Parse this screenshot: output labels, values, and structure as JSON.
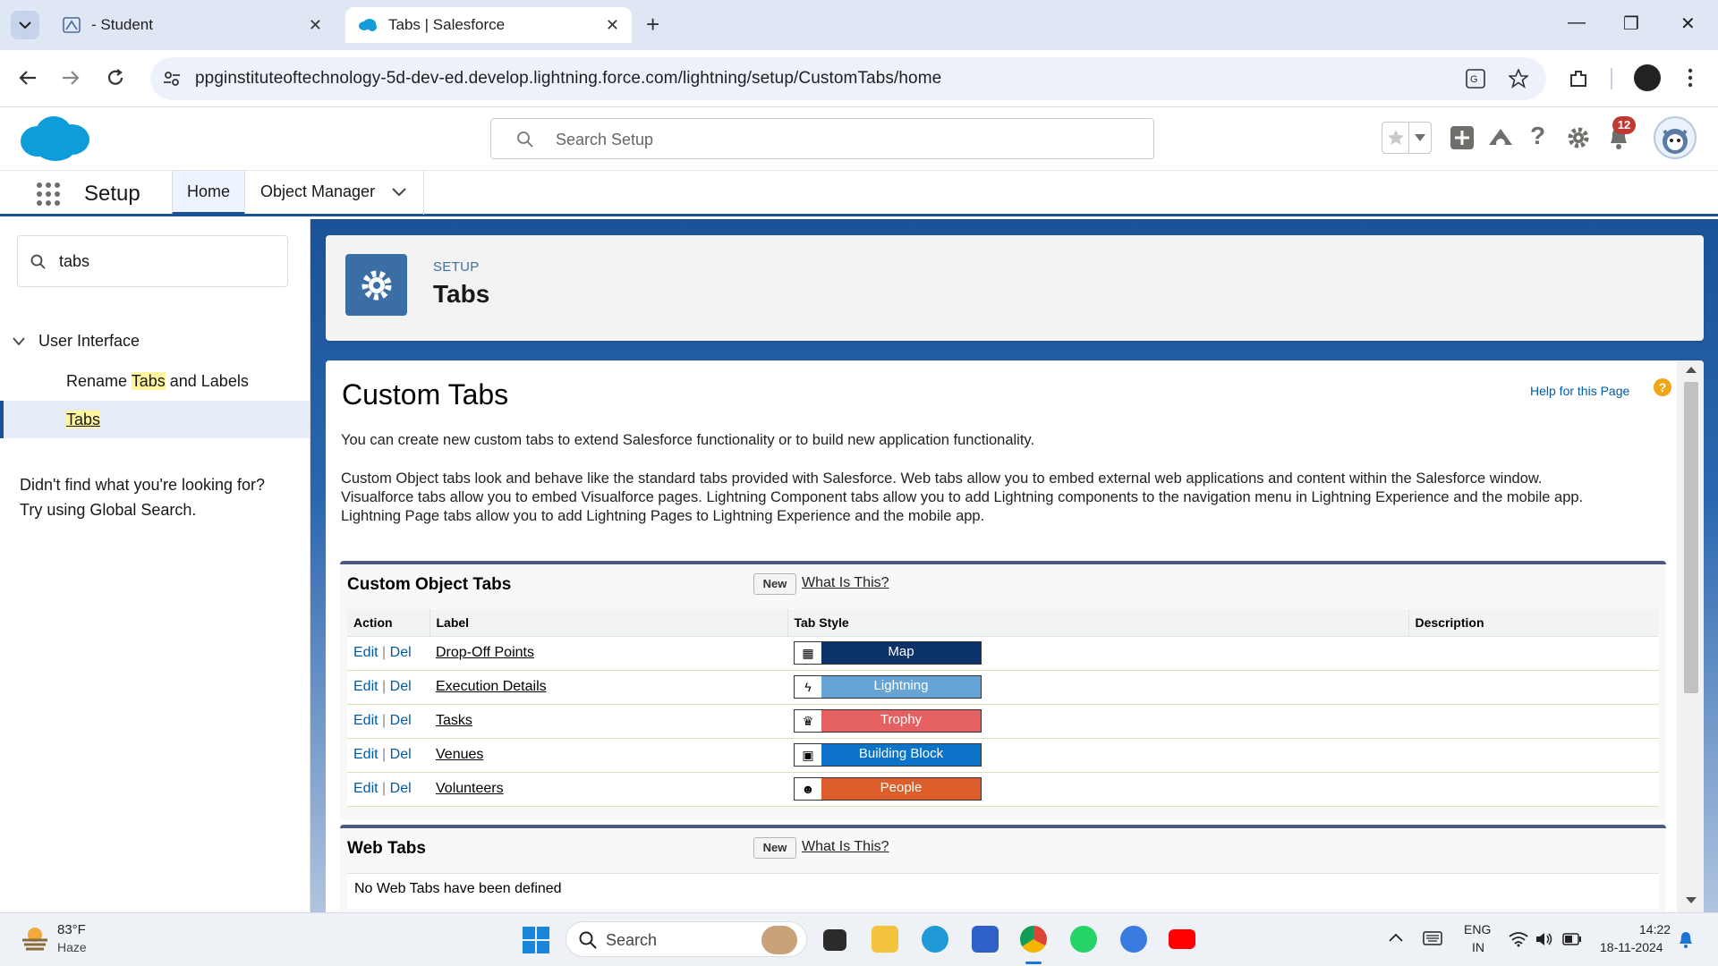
{
  "browser": {
    "tabs": [
      {
        "title": "- Student",
        "icon": "student-app-icon"
      },
      {
        "title": "Tabs | Salesforce",
        "icon": "salesforce-cloud-icon"
      }
    ],
    "url": "ppginstituteoftechnology-5d-dev-ed.develop.lightning.force.com/lightning/setup/CustomTabs/home"
  },
  "sf_header": {
    "search_placeholder": "Search Setup",
    "notification_count": "12"
  },
  "navbar": {
    "app_name": "Setup",
    "items": [
      {
        "label": "Home"
      },
      {
        "label": "Object Manager"
      }
    ]
  },
  "sidebar": {
    "quick_find_value": "tabs",
    "tree": {
      "group": "User Interface",
      "item1_pre": "Rename ",
      "item1_hl": "Tabs",
      "item1_post": " and Labels",
      "item2": "Tabs"
    },
    "not_found_line1": "Didn't find what you're looking for?",
    "not_found_line2": "Try using Global Search."
  },
  "page_header": {
    "eyebrow": "SETUP",
    "title": "Tabs"
  },
  "content": {
    "title": "Custom Tabs",
    "help_link": "Help for this Page",
    "intro": "You can create new custom tabs to extend Salesforce functionality or to build new application functionality.",
    "desc_line1": "Custom Object tabs look and behave like the standard tabs provided with Salesforce. Web tabs allow you to embed external web applications and content within the Salesforce window.",
    "desc_line2": "Visualforce tabs allow you to embed Visualforce pages. Lightning Component tabs allow you to add Lightning components to the navigation menu in Lightning Experience and the mobile app.",
    "desc_line3": "Lightning Page tabs allow you to add Lightning Pages to Lightning Experience and the mobile app."
  },
  "custom_object_tabs": {
    "title": "Custom Object Tabs",
    "new_label": "New",
    "what_label": "What Is This?",
    "columns": [
      "Action",
      "Label",
      "Tab Style",
      "Description"
    ],
    "edit": "Edit",
    "sep": "|",
    "del": "Del",
    "rows": [
      {
        "label": "Drop-Off Points",
        "style": "Map",
        "color": "#0b3269",
        "icon": "map-icon"
      },
      {
        "label": "Execution Details",
        "style": "Lightning",
        "color": "#66a4d6",
        "icon": "lightning-icon"
      },
      {
        "label": "Tasks",
        "style": "Trophy",
        "color": "#e56060",
        "icon": "trophy-icon"
      },
      {
        "label": "Venues",
        "style": "Building Block",
        "color": "#0b73c8",
        "icon": "building-block-icon"
      },
      {
        "label": "Volunteers",
        "style": "People",
        "color": "#dd5e2a",
        "icon": "people-icon"
      }
    ]
  },
  "web_tabs": {
    "title": "Web Tabs",
    "new_label": "New",
    "what_label": "What Is This?",
    "empty_text": "No Web Tabs have been defined"
  },
  "taskbar": {
    "temperature": "83°F",
    "condition": "Haze",
    "search_label": "Search",
    "lang1": "ENG",
    "lang2": "IN",
    "time": "14:22",
    "date": "18-11-2024"
  }
}
